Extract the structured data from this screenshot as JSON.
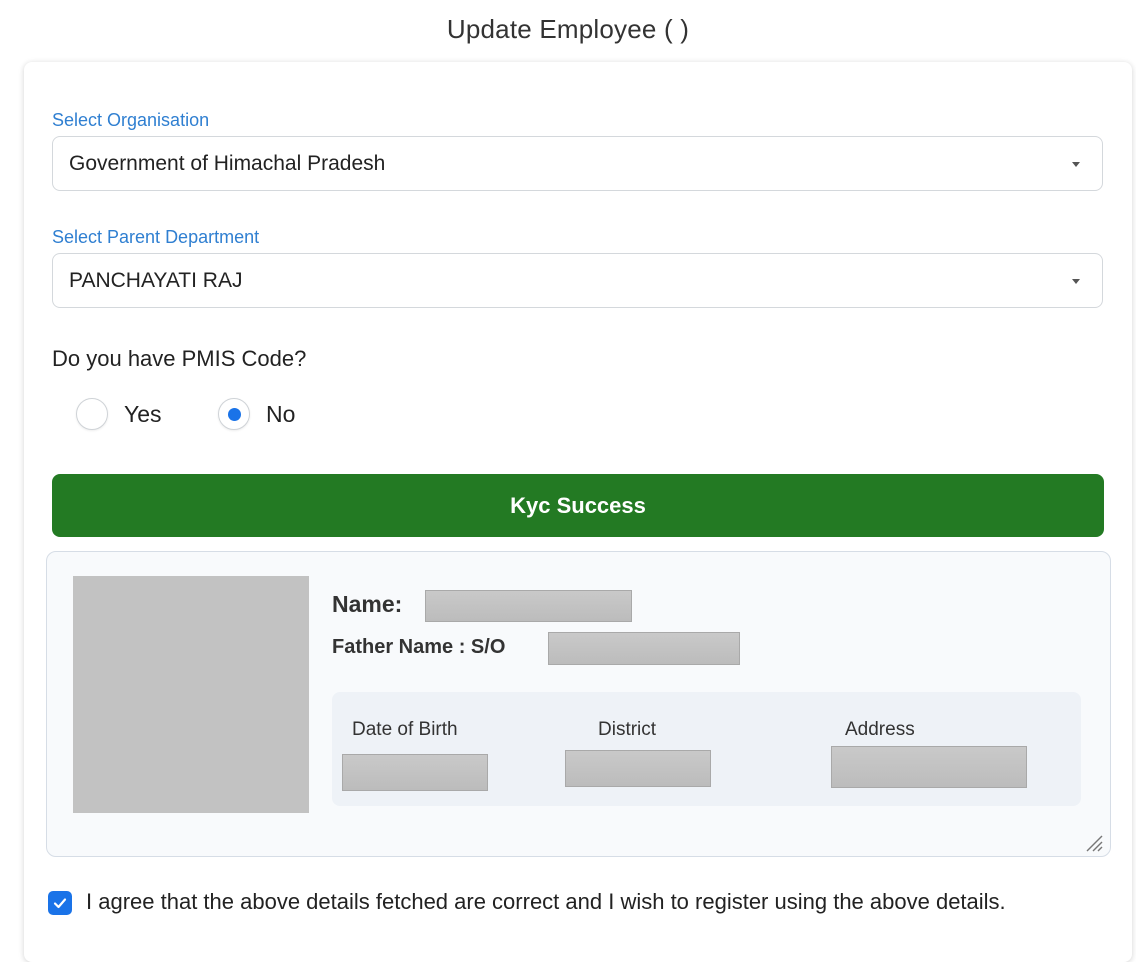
{
  "page": {
    "title": "Update Employee ( )"
  },
  "form": {
    "organisation": {
      "label": "Select Organisation",
      "value": "Government of Himachal Pradesh"
    },
    "parent_department": {
      "label": "Select Parent Department",
      "value": "PANCHAYATI RAJ"
    },
    "pmis_question": "Do you have PMIS Code?",
    "pmis_options": [
      {
        "label": "Yes",
        "checked": false
      },
      {
        "label": "No",
        "checked": true
      }
    ]
  },
  "kyc": {
    "status_label": "Kyc Success",
    "status_color": "#237a23",
    "name_label": "Name:",
    "father_label": "Father Name : S/O",
    "columns": [
      "Date of Birth",
      "District",
      "Address"
    ]
  },
  "agreement": {
    "checked": true,
    "text": "I agree that the above details fetched are correct and I wish to register using the above details."
  },
  "colors": {
    "accent": "#1a73e8",
    "label_blue": "#2f7fd1",
    "redaction": "#c2c2c2"
  }
}
